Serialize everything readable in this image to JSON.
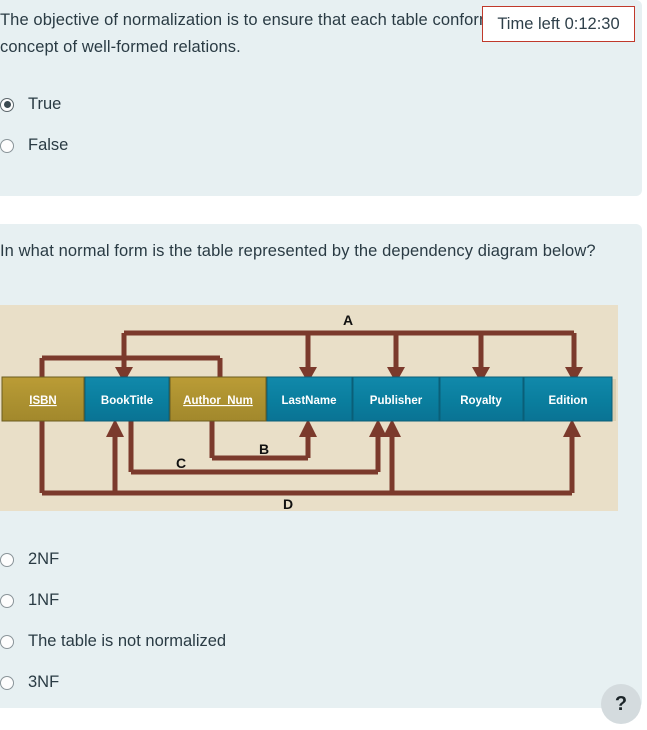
{
  "timer": {
    "label": "Time left 0:12:30"
  },
  "questions": [
    {
      "text": "The objective of normalization is to ensure that each table conforms to the concept of well-formed relations.",
      "options": [
        {
          "label": "True",
          "selected": true
        },
        {
          "label": "False",
          "selected": false
        }
      ]
    },
    {
      "text": "In what normal form is the table represented by the dependency diagram below?",
      "options": [
        {
          "label": "2NF",
          "selected": false
        },
        {
          "label": "1NF",
          "selected": false
        },
        {
          "label": "The table is not normalized",
          "selected": false
        },
        {
          "label": "3NF",
          "selected": false
        }
      ]
    }
  ],
  "diagram": {
    "columns": [
      {
        "name": "ISBN",
        "key": true,
        "color": "#b29432"
      },
      {
        "name": "BookTitle",
        "key": false,
        "color": "#0d7e9e"
      },
      {
        "name": "Author_Num",
        "key": true,
        "color": "#b29432"
      },
      {
        "name": "LastName",
        "key": false,
        "color": "#0d7e9e"
      },
      {
        "name": "Publisher",
        "key": false,
        "color": "#0d7e9e"
      },
      {
        "name": "Royalty",
        "key": false,
        "color": "#0d7e9e"
      },
      {
        "name": "Edition",
        "key": false,
        "color": "#0d7e9e"
      }
    ],
    "dependency_labels": [
      "A",
      "B",
      "C",
      "D"
    ],
    "arrow_color": "#7b3a2c",
    "background": "#e9dfc8"
  },
  "help": {
    "label": "?"
  }
}
